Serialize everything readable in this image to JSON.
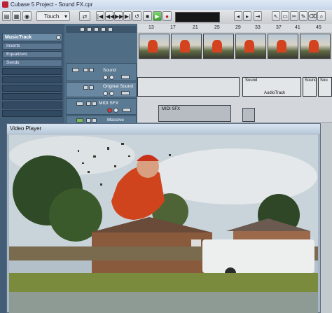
{
  "window": {
    "title": "Cubase 5 Project - Sound FX.cpr"
  },
  "toolbar": {
    "automation_mode": "Touch"
  },
  "ruler": {
    "bars": [
      "13",
      "17",
      "21",
      "25",
      "29",
      "33",
      "37",
      "41",
      "45"
    ]
  },
  "inspector": {
    "track_name": "MusicTrack",
    "sections": [
      "Inserts",
      "Equalizers",
      "Sends"
    ]
  },
  "tracks": [
    {
      "name": "Sound"
    },
    {
      "name": "Original Sound"
    },
    {
      "name": "MIDI SFX"
    },
    {
      "name": "Massive"
    }
  ],
  "events": {
    "sound_label_1": "Sound",
    "sound_label_2": "Sound",
    "sound_label_3": "Sou",
    "audio_track_label": "AudioTrack",
    "midi_event_label": "MIDI SFX"
  },
  "video_player": {
    "title": "Video Player"
  },
  "colors": {
    "play_button": "#3ea22e",
    "record_button": "#cc1111",
    "inspector_bg": "#435d77"
  }
}
